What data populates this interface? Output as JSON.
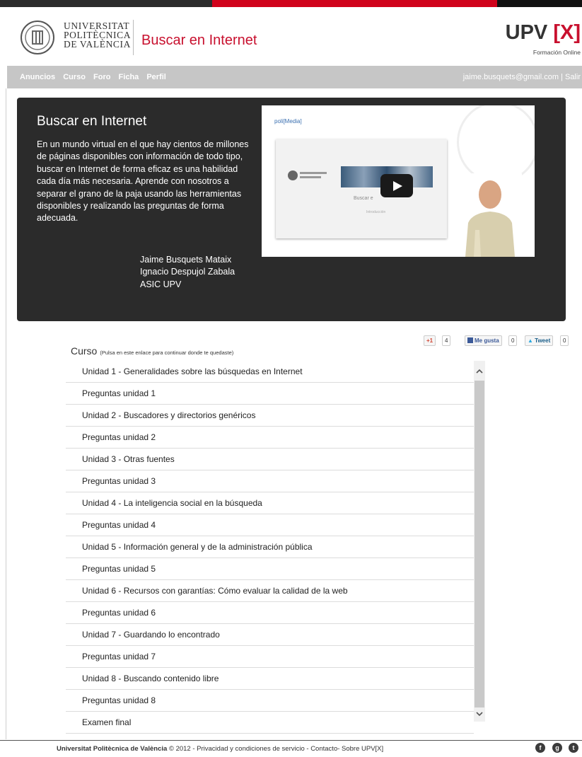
{
  "header": {
    "university_lines": [
      "UNIVERSITAT",
      "POLITÈCNICA",
      "DE VALÈNCIA"
    ],
    "site_title": "Buscar en Internet",
    "brand": "UPV",
    "brand_x": "[X]",
    "brand_sub": "Formación Online"
  },
  "nav": {
    "links": [
      "Anuncios",
      "Curso",
      "Foro",
      "Ficha",
      "Perfil"
    ],
    "user": "jaime.busquets@gmail.com | Salir"
  },
  "hero": {
    "title": "Buscar en Internet",
    "description": "En un mundo virtual en el que hay cientos de millones de páginas disponibles con información de todo tipo, buscar en Internet de forma eficaz es una habilidad cada día más necesaria. Aprende con nosotros a separar el grano de la paja usando las herramientas disponibles y realizando las preguntas de forma adecuada.",
    "authors": [
      "Jaime Busquets Mataix",
      "Ignacio Despujol Zabala",
      "ASIC UPV"
    ],
    "video": {
      "poli_label": "poli[Media]",
      "slide_title": "Buscar e",
      "slide_sub": "Introducción"
    }
  },
  "social": {
    "gplus_label": "+1",
    "gplus_count": "4",
    "fb_label": "Me gusta",
    "fb_count": "0",
    "tw_label": "Tweet",
    "tw_count": "0"
  },
  "course": {
    "title": "Curso",
    "hint": "(Pulsa en este enlace para continuar donde te quedaste)",
    "items": [
      "Unidad 1 - Generalidades sobre las búsquedas en Internet",
      "Preguntas unidad 1",
      "Unidad 2 - Buscadores y directorios genéricos",
      "Preguntas unidad 2",
      "Unidad 3 - Otras fuentes",
      "Preguntas unidad 3",
      "Unidad 4 - La inteligencia social en la búsqueda",
      "Preguntas unidad 4",
      "Unidad 5 - Información general y de la administración pública",
      "Preguntas unidad 5",
      "Unidad 6 - Recursos con garantías: Cómo evaluar la calidad de la web",
      "Preguntas unidad 6",
      "Unidad 7 - Guardando lo encontrado",
      "Preguntas unidad 7",
      "Unidad 8 - Buscando contenido libre",
      "Preguntas unidad 8",
      "Examen final"
    ]
  },
  "footer": {
    "university": "Universitat Politècnica de València",
    "copyright": "© 2012 - Privacidad y condiciones de servicio - Contacto- Sobre UPV[X]",
    "icons": [
      "facebook-icon",
      "google-icon",
      "twitter-icon"
    ]
  },
  "colors": {
    "accent": "#c8102e",
    "nav_bg": "#c6c6c6",
    "hero_bg": "#2b2b2b"
  }
}
